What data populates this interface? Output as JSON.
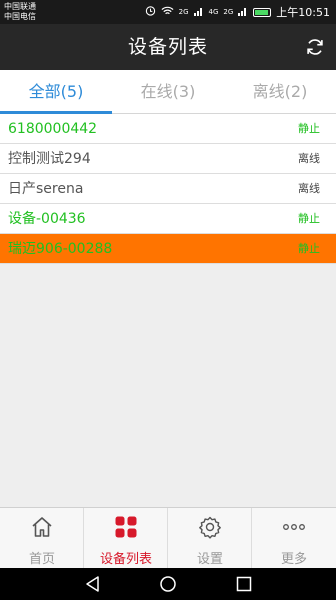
{
  "status_bar": {
    "carrier_1": "中国联通",
    "carrier_2": "中国电信",
    "signal_1": "2G",
    "signal_2": "4G",
    "signal_3": "2G",
    "time": "上午10:51"
  },
  "header": {
    "title": "设备列表",
    "refresh_icon": "refresh-icon"
  },
  "tabs": [
    {
      "label": "全部(5)",
      "active": true
    },
    {
      "label": "在线(3)",
      "active": false
    },
    {
      "label": "离线(2)",
      "active": false
    }
  ],
  "devices": [
    {
      "name": "6180000442",
      "status": "静止",
      "state": "online"
    },
    {
      "name": "控制测试294",
      "status": "离线",
      "state": "offline"
    },
    {
      "name": "日产serena",
      "status": "离线",
      "state": "offline"
    },
    {
      "name": "设备-00436",
      "status": "静止",
      "state": "online"
    },
    {
      "name": "瑞迈906-00288",
      "status": "静止",
      "state": "online-selected"
    }
  ],
  "bottom_nav": [
    {
      "label": "首页",
      "icon": "home-icon",
      "active": false
    },
    {
      "label": "设备列表",
      "icon": "grid-icon",
      "active": true
    },
    {
      "label": "设置",
      "icon": "gear-icon",
      "active": false
    },
    {
      "label": "更多",
      "icon": "more-icon",
      "active": false
    }
  ],
  "colors": {
    "accent_blue": "#2e8bd8",
    "online_green": "#22c022",
    "selected_row": "#ff7400",
    "nav_active_red": "#d7192b",
    "title_bar": "#282828"
  }
}
